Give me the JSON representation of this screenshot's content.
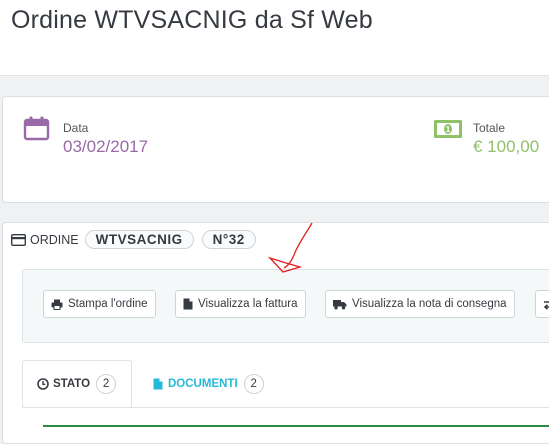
{
  "page": {
    "title": "Ordine WTVSACNIG da Sf Web"
  },
  "summary": {
    "date_label": "Data",
    "date_value": "03/02/2017",
    "total_label": "Totale",
    "total_value": "€ 100,00",
    "colors": {
      "date": "#9a6aa8",
      "total": "#8fc169"
    }
  },
  "order": {
    "label": "ORDINE",
    "reference": "WTVSACNIG",
    "number": "N°32"
  },
  "actions": {
    "print": "Stampa l'ordine",
    "invoice": "Visualizza la fattura",
    "delivery_note": "Visualizza la nota di consegna"
  },
  "tabs": [
    {
      "label": "STATO",
      "count": "2",
      "icon": "clock-icon"
    },
    {
      "label": "DOCUMENTI",
      "count": "2",
      "icon": "file-icon"
    }
  ]
}
